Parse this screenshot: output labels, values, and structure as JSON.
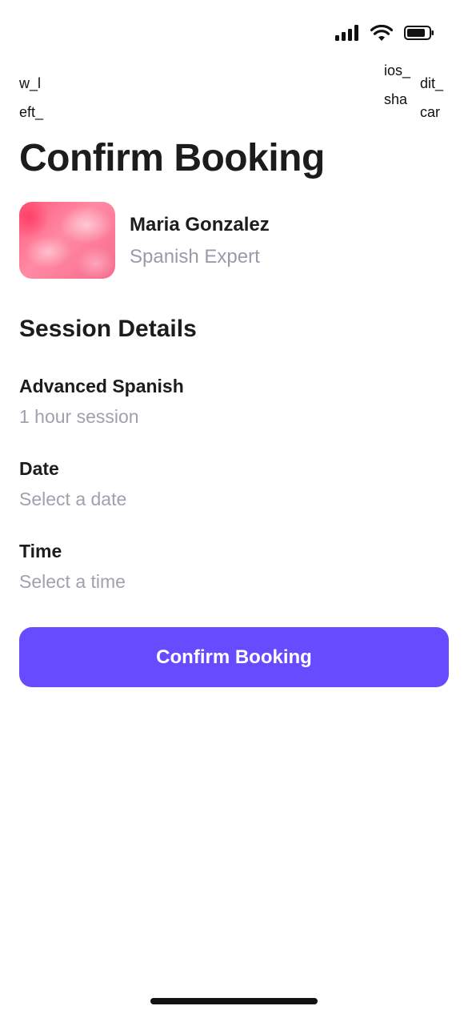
{
  "broken_text": {
    "left": [
      "w_l",
      "eft_"
    ],
    "middle": [
      "ios_",
      "sha",
      "..."
    ],
    "right": [
      "dit_",
      "car"
    ]
  },
  "page": {
    "title": "Confirm Booking"
  },
  "tutor": {
    "name": "Maria Gonzalez",
    "role": "Spanish Expert"
  },
  "session": {
    "heading": "Session Details",
    "course_label": "Advanced Spanish",
    "course_value": "1 hour session",
    "date_label": "Date",
    "date_value": "Select a date",
    "time_label": "Time",
    "time_value": "Select a time"
  },
  "actions": {
    "confirm_label": "Confirm Booking"
  },
  "colors": {
    "accent": "#664bff",
    "muted": "#a0a0ae",
    "text": "#1c1c1e"
  },
  "icons": {
    "status": [
      "cellular-signal-icon",
      "wifi-icon",
      "battery-icon"
    ]
  }
}
